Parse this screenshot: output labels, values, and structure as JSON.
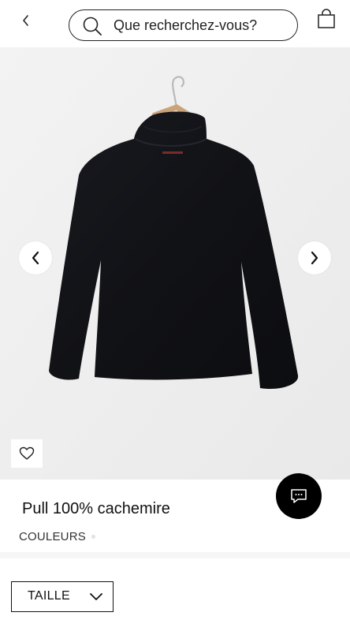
{
  "header": {
    "back_icon": "chevron-left-icon",
    "search_placeholder": "Que recherchez-vous?",
    "search_icon": "search-icon",
    "bag_icon": "shopping-bag-icon"
  },
  "gallery": {
    "image_alt": "black cashmere turtleneck sweater on a wooden hanger",
    "prev_icon": "chevron-left-icon",
    "next_icon": "chevron-right-icon",
    "favorite_icon": "heart-icon"
  },
  "chat": {
    "icon": "chat-bubble-icon",
    "background": "#000000"
  },
  "product": {
    "title": "Pull 100% cachemire",
    "colors_label": "COULEURS"
  },
  "size_selector": {
    "label": "TAILLE",
    "icon": "chevron-down-icon"
  },
  "colors": {
    "text": "#111111",
    "image_background": "#efefef",
    "sweater": "#121317"
  }
}
